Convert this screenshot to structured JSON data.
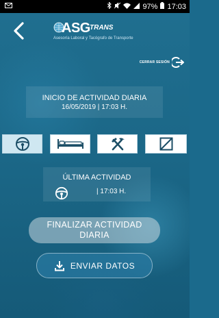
{
  "status_bar": {
    "battery": "97%",
    "time": "17:03",
    "icons": [
      "mail-icon",
      "bluetooth-icon",
      "mute-icon",
      "wifi-icon",
      "signal-icon",
      "battery-icon"
    ]
  },
  "header": {
    "back_icon": "chevron-left-icon",
    "logo": {
      "word": "ASG",
      "suffix": "TRANS",
      "tagline": "Asesoría Laboral y Tacógrafo de Transporte"
    }
  },
  "logout": {
    "label": "CERRAR SESIÓN",
    "icon": "logout-icon"
  },
  "activity_start": {
    "title": "INICIO DE ACTIVIDAD DIARIA",
    "datetime": "16/05/2019 | 17:03 H."
  },
  "activity_tabs": [
    {
      "name": "driving",
      "icon": "steering-wheel-icon",
      "active": true
    },
    {
      "name": "rest",
      "icon": "bed-icon",
      "active": false
    },
    {
      "name": "work",
      "icon": "hammer-pickaxe-icon",
      "active": false
    },
    {
      "name": "availability",
      "icon": "square-slash-icon",
      "active": false
    }
  ],
  "last_activity": {
    "title": "ÚLTIMA ACTIVIDAD",
    "icon": "steering-wheel-icon",
    "time": "| 17:03 H."
  },
  "buttons": {
    "finish": "FINALIZAR ACTIVIDAD DIARIA",
    "send": "ENVIAR DATOS",
    "send_icon": "download-icon"
  },
  "colors": {
    "background": "#1b6a8c",
    "tile": "#ffffff",
    "tile_active": "#cfe7f1",
    "icon_dark": "#1c4e66"
  }
}
